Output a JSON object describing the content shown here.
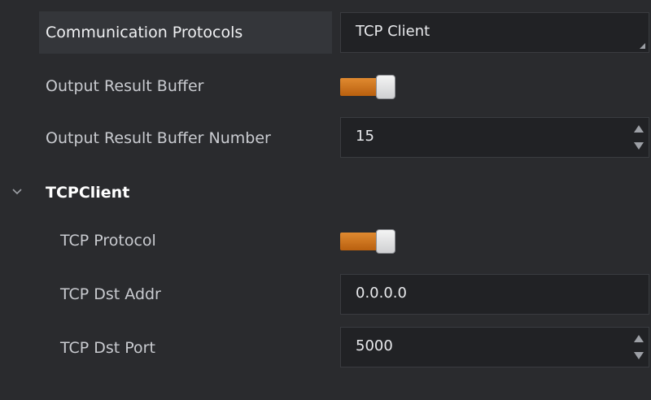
{
  "properties": {
    "comm_protocols": {
      "label": "Communication Protocols",
      "value": "TCP Client"
    },
    "output_result_buffer": {
      "label": "Output Result Buffer",
      "enabled": true
    },
    "output_result_buffer_number": {
      "label": "Output Result Buffer Number",
      "value": "15"
    }
  },
  "group": {
    "title": "TCPClient",
    "icon": "chevron-down-icon",
    "expanded": true,
    "items": {
      "tcp_protocol": {
        "label": "TCP Protocol",
        "enabled": true
      },
      "tcp_dst_addr": {
        "label": "TCP Dst Addr",
        "value": "0.0.0.0"
      },
      "tcp_dst_port": {
        "label": "TCP Dst Port",
        "value": "5000"
      }
    }
  },
  "colors": {
    "background": "#2a2b2e",
    "field_bg": "#212225",
    "toggle_on": "#d0731c",
    "selected_row": "#34363a"
  }
}
